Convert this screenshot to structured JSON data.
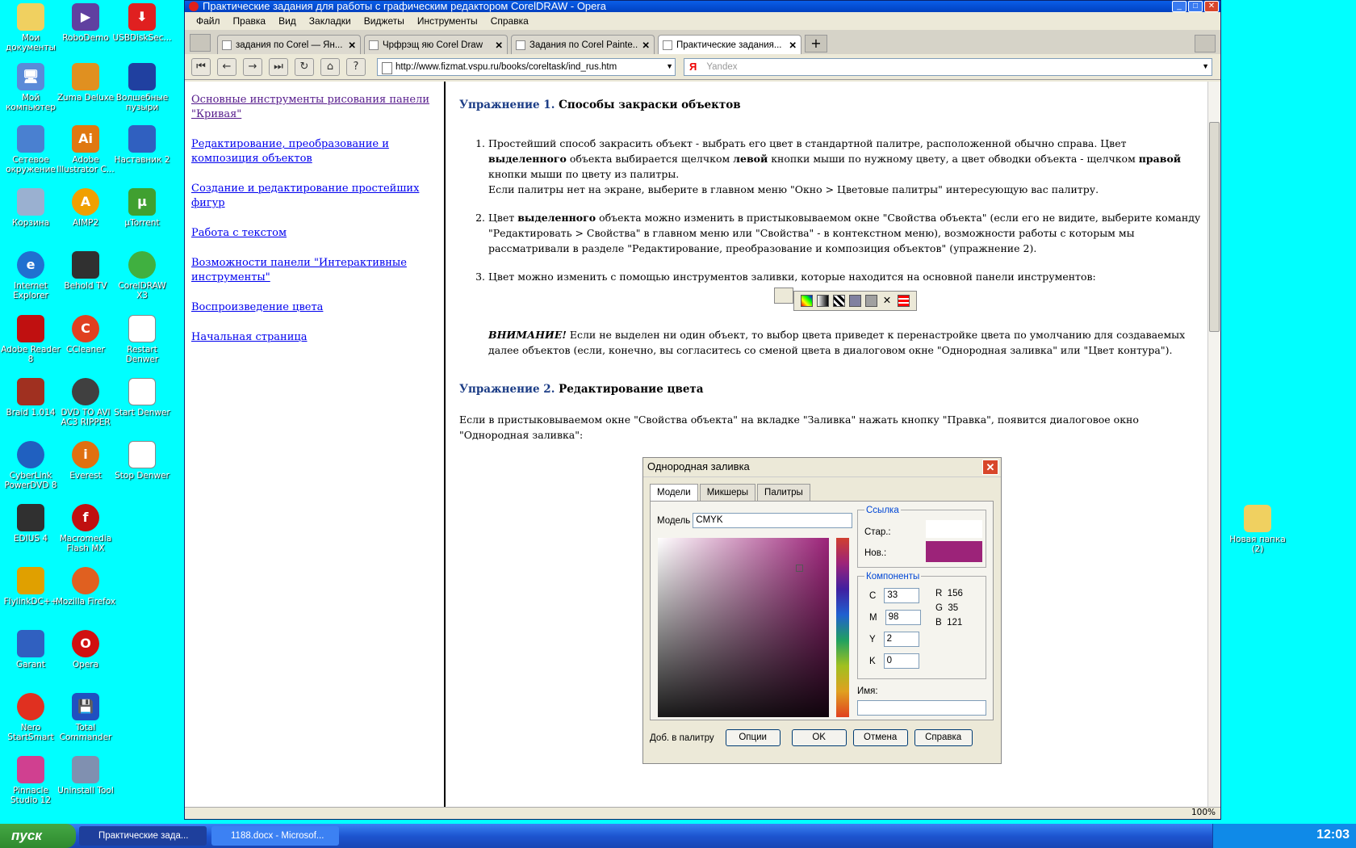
{
  "desktop": {
    "icons": [
      {
        "label": "Мои документы"
      },
      {
        "label": "RoboDemo"
      },
      {
        "label": "USBDiskSec..."
      },
      {
        "label": "Мой компьютер"
      },
      {
        "label": "Zuma Deluxe"
      },
      {
        "label": "Волшебные пузыри"
      },
      {
        "label": "Сетевое окружение"
      },
      {
        "label": "Adobe Illustrator C..."
      },
      {
        "label": "Наставник 2"
      },
      {
        "label": "Корзина"
      },
      {
        "label": "AIMP2"
      },
      {
        "label": "µTorrent"
      },
      {
        "label": "Internet Explorer"
      },
      {
        "label": "Behold TV"
      },
      {
        "label": "CorelDRAW X3"
      },
      {
        "label": "Adobe Reader 8"
      },
      {
        "label": "CCleaner"
      },
      {
        "label": "Restart Denwer"
      },
      {
        "label": "Braid 1.014"
      },
      {
        "label": "DVD TO AVI AC3 RIPPER"
      },
      {
        "label": "Start Denwer"
      },
      {
        "label": "CyberLink PowerDVD 8"
      },
      {
        "label": "Everest"
      },
      {
        "label": "Stop Denwer"
      },
      {
        "label": "EDIUS 4"
      },
      {
        "label": "Macromedia Flash MX"
      },
      {
        "label": "FlylinkDC++"
      },
      {
        "label": "Mozilla Firefox"
      },
      {
        "label": "Garant"
      },
      {
        "label": "Opera"
      },
      {
        "label": "Nero StartSmart"
      },
      {
        "label": "Total Commander"
      },
      {
        "label": "Pinnacle Studio 12"
      },
      {
        "label": "Uninstall Tool"
      }
    ],
    "folder": {
      "label": "Новая папка (2)"
    }
  },
  "window": {
    "title": "Практические задания для работы с графическим редактором CorelDRAW - Opera",
    "menu": [
      "Файл",
      "Правка",
      "Вид",
      "Закладки",
      "Виджеты",
      "Инструменты",
      "Справка"
    ],
    "tabs": [
      {
        "label": "задания по Corel — Ян..."
      },
      {
        "label": "Чрфрэщ яю Corel Draw"
      },
      {
        "label": "Задания по Corel Painte..."
      },
      {
        "label": "Практические задания..."
      }
    ],
    "url": "http://www.fizmat.vspu.ru/books/coreltask/ind_rus.htm",
    "search": {
      "engine": "Я",
      "placeholder": "Yandex"
    }
  },
  "nav_links": [
    "Основные инструменты рисования панели \"Кривая\"",
    "Редактирование, преобразование и композиция объектов",
    "Создание и редактирование простейших фигур",
    "Работа с текстом",
    "Возможности панели \"Интерактивные инструменты\"",
    "Воспроизведение цвета",
    "Начальная страница"
  ],
  "article": {
    "ex1": {
      "num": "Упражнение 1.",
      "title": "Способы закраски объектов"
    },
    "items": [
      {
        "p1": "Простейший способ закрасить объект - выбрать его цвет в стандартной палитре, расположенной обычно справа. Цвет ",
        "b1": "выделенного",
        "p2": " объекта выбирается щелчком ",
        "b2": "левой",
        "p3": " кнопки мыши по нужному цвету, а цвет обводки объекта - щелчком ",
        "b3": "правой",
        "p4": " кнопки мыши по цвету из палитры.",
        "p5": "Если палитры нет на экране, выберите в главном меню \"Окно > Цветовые палитры\" интересующую вас палитру."
      },
      {
        "p1": "Цвет ",
        "b1": "выделенного",
        "p2": " объекта можно изменить в пристыковываемом окне \"Свойства объекта\" (если его не видите, выберите команду \"Редактировать > Свойства\" в главном меню или \"Свойства\" - в контекстном меню), возможности работы с которым мы рассматривали в разделе \"Редактирование, преобразование и композиция объектов\" (упражнение 2)."
      },
      {
        "p1": "Цвет можно изменить с помощью инструментов заливки, которые находится на основной панели инструментов:"
      }
    ],
    "warn_label": "ВНИМАНИЕ!",
    "warn_text": " Если не выделен ни один объект, то выбор цвета приведет к перенастройке цвета по умолчанию для создаваемых далее объектов (если, конечно, вы согласитесь со сменой цвета в диалоговом окне \"Однородная заливка\" или \"Цвет контура\").",
    "ex2": {
      "num": "Упражнение 2.",
      "title": "Редактирование цвета"
    },
    "ex2_text": "Если в пристыковываемом окне \"Свойства объекта\" на вкладке \"Заливка\" нажать кнопку \"Правка\", появится диалоговое окно \"Однородная заливка\":"
  },
  "dialog": {
    "title": "Однородная заливка",
    "tabs": [
      "Модели",
      "Микшеры",
      "Палитры"
    ],
    "model_label": "Модель",
    "model_value": "CMYK",
    "ref_label": "Ссылка",
    "old_label": "Стар.:",
    "new_label": "Нов.:",
    "new_color": "#9c2379",
    "components_label": "Компоненты",
    "cmyk": [
      {
        "k": "C",
        "v": "33"
      },
      {
        "k": "M",
        "v": "98"
      },
      {
        "k": "Y",
        "v": "2"
      },
      {
        "k": "K",
        "v": "0"
      }
    ],
    "rgb": [
      {
        "k": "R",
        "v": "156"
      },
      {
        "k": "G",
        "v": "35"
      },
      {
        "k": "B",
        "v": "121"
      }
    ],
    "name_label": "Имя:",
    "add_palette": "Доб. в палитру",
    "options": "Опции",
    "ok": "OK",
    "cancel": "Отмена",
    "help": "Справка"
  },
  "statusbar": {
    "zoom": "100%"
  },
  "taskbar": {
    "start": "пуск",
    "buttons": [
      "Практические зада...",
      "1188.docx - Microsof..."
    ],
    "clock": "12:03"
  }
}
